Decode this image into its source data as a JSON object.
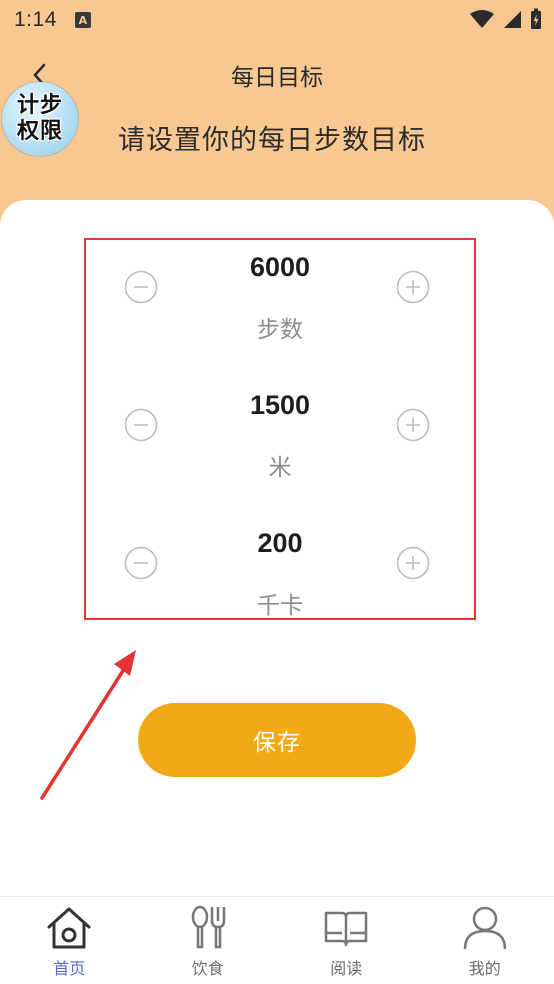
{
  "status_bar": {
    "time": "1:14",
    "notification_icon": "A"
  },
  "header": {
    "title": "每日目标",
    "subtitle": "请设置你的每日步数目标",
    "badge_line1": "计步",
    "badge_line2": "权限"
  },
  "goals": [
    {
      "value": "6000",
      "unit": "步数"
    },
    {
      "value": "1500",
      "unit": "米"
    },
    {
      "value": "200",
      "unit": "千卡"
    }
  ],
  "save_label": "保存",
  "nav": [
    {
      "label": "首页",
      "icon": "home-icon",
      "active": true
    },
    {
      "label": "饮食",
      "icon": "utensils-icon",
      "active": false
    },
    {
      "label": "阅读",
      "icon": "book-icon",
      "active": false
    },
    {
      "label": "我的",
      "icon": "user-icon",
      "active": false
    }
  ],
  "colors": {
    "header_bg": "#f7c891",
    "accent": "#f2a916",
    "highlight_border": "#e53232",
    "nav_active": "#5a67d8"
  }
}
